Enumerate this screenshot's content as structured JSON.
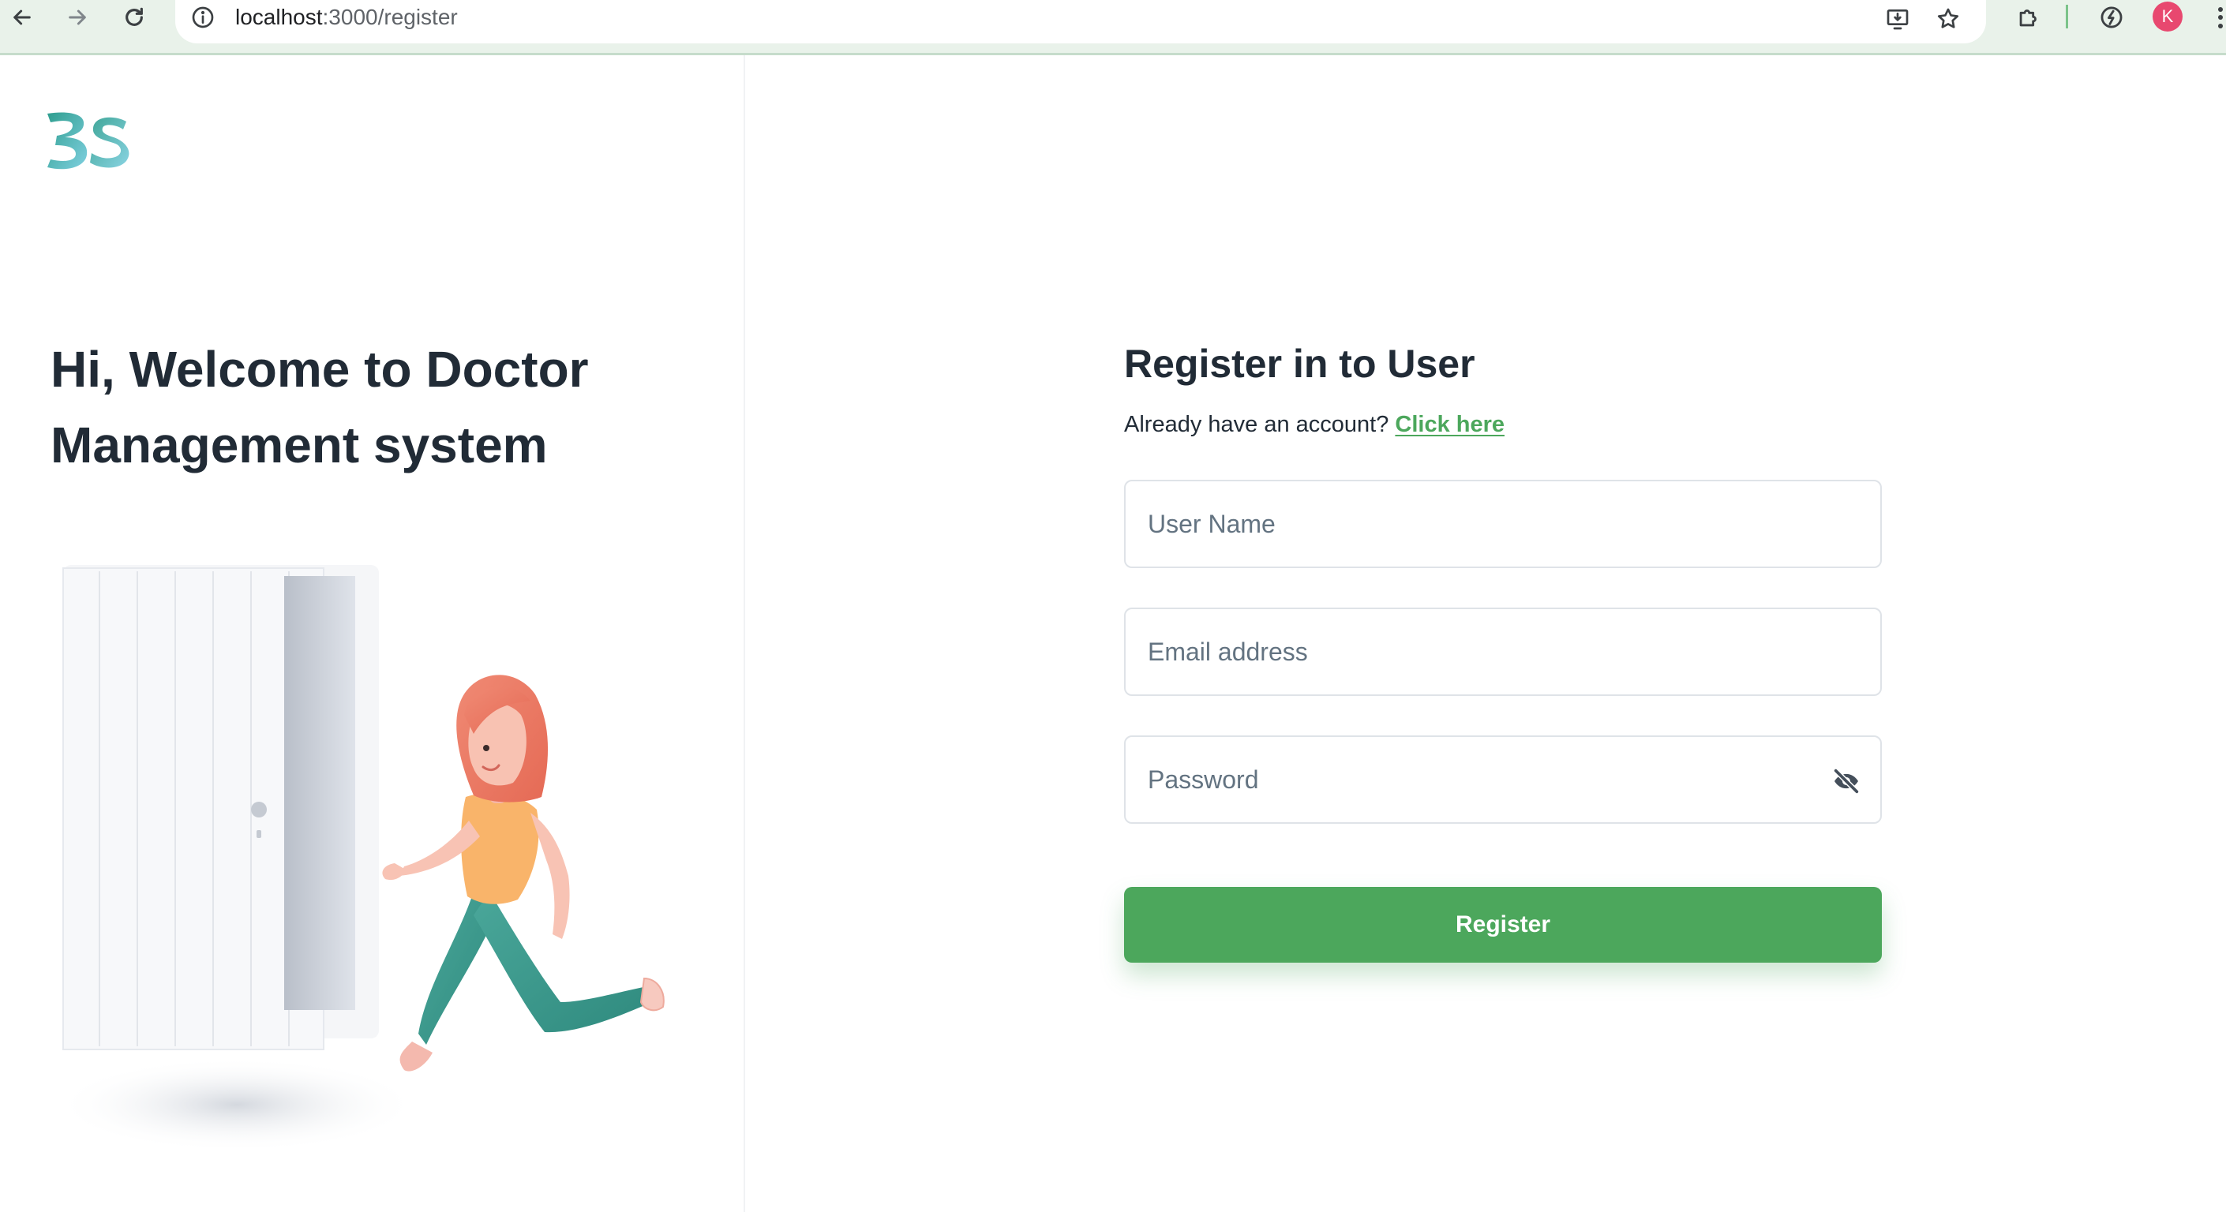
{
  "browser": {
    "url_host": "localhost",
    "url_path": ":3000/register",
    "profile_initial": "K",
    "icons": [
      "back-arrow-icon",
      "forward-arrow-icon",
      "reload-icon",
      "site-info-icon",
      "install-app-icon",
      "bookmark-star-icon",
      "extensions-puzzle-icon",
      "performance-icon",
      "kebab-menu-icon"
    ]
  },
  "brand": {
    "logo_icon": "bs-logo-icon",
    "colors": [
      "#2f9e8f",
      "#7fd0e0"
    ]
  },
  "left": {
    "welcome_heading": "Hi, Welcome to Doctor Management system",
    "illustration_icon": "woman-running-through-door-illustration"
  },
  "form": {
    "title": "Register in to User",
    "account_prompt": "Already have an account?",
    "login_link": "Click here",
    "fields": {
      "username_placeholder": "User Name",
      "email_placeholder": "Email address",
      "password_placeholder": "Password"
    },
    "password_toggle_icon": "eye-off-icon",
    "submit_label": "Register"
  },
  "colors": {
    "accent": "#4ca75c",
    "heading": "#212b36",
    "border": "#dfe3e8"
  }
}
